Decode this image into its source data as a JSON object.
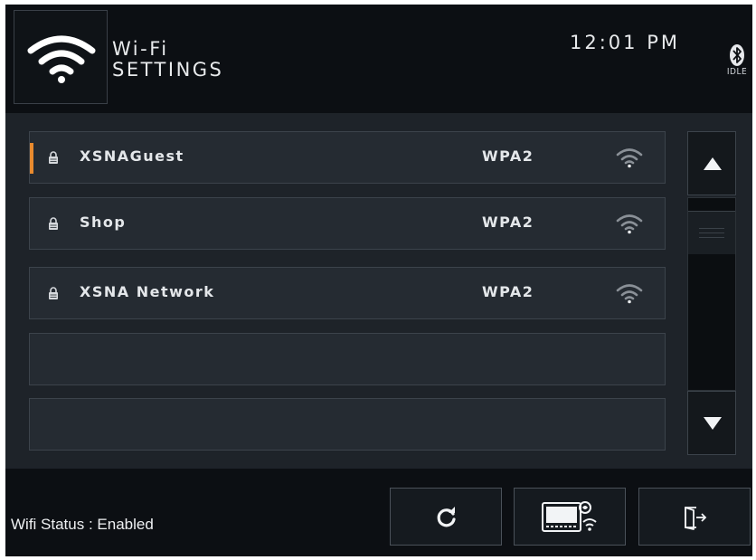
{
  "header": {
    "title_line1": "Wi-Fi",
    "title_line2": "SETTINGS",
    "time": "12:01 PM",
    "bluetooth_state": "IDLE",
    "logo_icon": "wifi-icon"
  },
  "networks": [
    {
      "name": "XSNAGuest",
      "security": "WPA2",
      "selected": true,
      "signal_icon": "wifi-signal-icon",
      "lock_icon": "lock-icon"
    },
    {
      "name": "Shop",
      "security": "WPA2",
      "selected": false,
      "signal_icon": "wifi-signal-icon",
      "lock_icon": "lock-icon"
    },
    {
      "name": "XSNA Network",
      "security": "WPA2",
      "selected": false,
      "signal_icon": "wifi-signal-icon",
      "lock_icon": "lock-icon"
    },
    {
      "name": "",
      "security": "",
      "selected": false
    },
    {
      "name": "",
      "security": "",
      "selected": false
    }
  ],
  "scroll": {
    "up_icon": "arrow-up-icon",
    "down_icon": "arrow-down-icon"
  },
  "footer": {
    "wifi_status": "Wifi Status : Enabled",
    "buttons": [
      {
        "icon": "refresh-icon"
      },
      {
        "icon": "oven-wifi-icon"
      },
      {
        "icon": "exit-icon"
      }
    ]
  },
  "colors": {
    "accent": "#e88a2e",
    "background": "#1e2329",
    "header_bg": "#0c0f13",
    "text": "#e4e7ea"
  }
}
